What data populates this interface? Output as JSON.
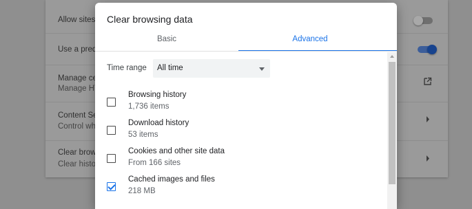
{
  "background": {
    "rows": [
      {
        "title": "Allow sites",
        "subtitle": "",
        "control": "toggle-off"
      },
      {
        "title": "Use a predi",
        "subtitle": "",
        "control": "toggle-on"
      },
      {
        "title": "Manage ce",
        "subtitle": "Manage HT",
        "control": "external-link-icon"
      },
      {
        "title": "Content Se",
        "subtitle": "Control wh",
        "control": "chevron-right-icon"
      },
      {
        "title": "Clear brows",
        "subtitle": "Clear histo",
        "control": "chevron-right-icon"
      }
    ]
  },
  "dialog": {
    "title": "Clear browsing data",
    "tabs": [
      {
        "label": "Basic",
        "active": false
      },
      {
        "label": "Advanced",
        "active": true
      }
    ],
    "time_range": {
      "label": "Time range",
      "value": "All time"
    },
    "items": [
      {
        "label": "Browsing history",
        "detail": "1,736 items",
        "checked": false
      },
      {
        "label": "Download history",
        "detail": "53 items",
        "checked": false
      },
      {
        "label": "Cookies and other site data",
        "detail": "From 166 sites",
        "checked": false
      },
      {
        "label": "Cached images and files",
        "detail": "218 MB",
        "checked": true
      }
    ]
  },
  "colors": {
    "accent": "#1a73e8",
    "overlay": "#8f8f8f"
  }
}
